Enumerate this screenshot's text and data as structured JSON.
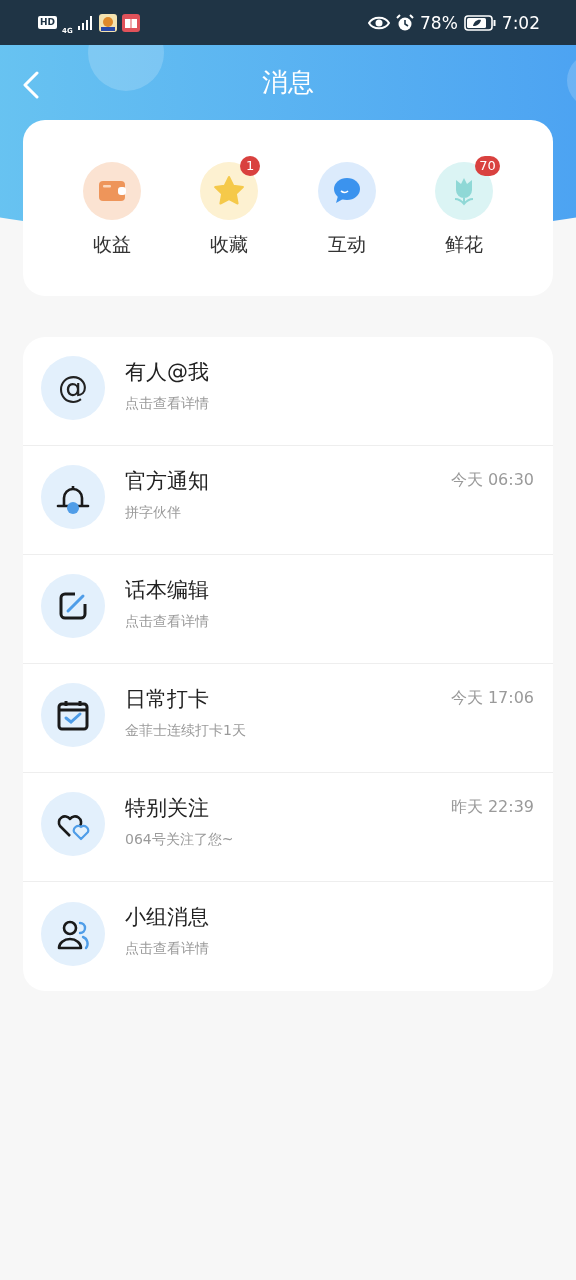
{
  "status_bar": {
    "hd": "HD",
    "network": "4G",
    "battery": "78%",
    "time": "7:02"
  },
  "header": {
    "title": "消息"
  },
  "quick_actions": [
    {
      "kind": "wallet",
      "label": "收益"
    },
    {
      "kind": "star",
      "label": "收藏",
      "badge": "1"
    },
    {
      "kind": "chat",
      "label": "互动"
    },
    {
      "kind": "flower",
      "label": "鲜花",
      "badge": "70"
    }
  ],
  "messages": [
    {
      "kind": "mention",
      "icon": "@",
      "title": "有人@我",
      "subtitle": "点击查看详情"
    },
    {
      "kind": "bell",
      "title": "官方通知",
      "subtitle": "拼字伙伴",
      "time": "今天 06:30"
    },
    {
      "kind": "edit",
      "title": "话本编辑",
      "subtitle": "点击查看详情"
    },
    {
      "kind": "calendar",
      "title": "日常打卡",
      "subtitle": "金菲士连续打卡1天",
      "time": "今天 17:06"
    },
    {
      "kind": "hearts",
      "title": "特别关注",
      "subtitle": "064号关注了您~",
      "time": "昨天 22:39"
    },
    {
      "kind": "group",
      "title": "小组消息",
      "subtitle": "点击查看详情"
    }
  ]
}
